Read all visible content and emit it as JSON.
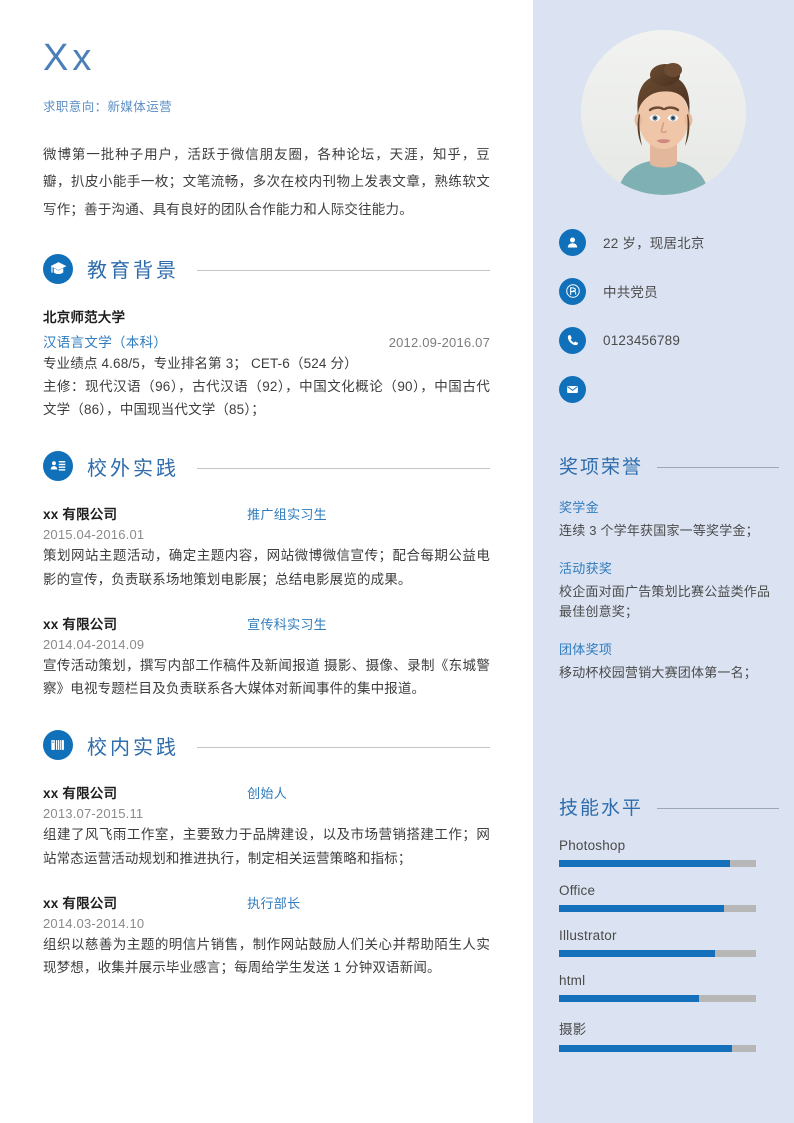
{
  "profile": {
    "name": "Xx",
    "objective": "求职意向：新媒体运营",
    "summary": "微博第一批种子用户，活跃于微信朋友圈，各种论坛，天涯，知乎，豆瓣，扒皮小能手一枚；文笔流畅，多次在校内刊物上发表文章，熟练软文写作；善于沟通、具有良好的团队合作能力和人际交往能力。"
  },
  "contact": {
    "items": [
      {
        "icon": "person-icon",
        "text": "22 岁，现居北京"
      },
      {
        "icon": "party-emblem-icon",
        "text": "中共党员"
      },
      {
        "icon": "phone-icon",
        "text": "0123456789"
      },
      {
        "icon": "mail-icon",
        "text": ""
      }
    ]
  },
  "education": {
    "title": "教育背景",
    "icon": "graduation-cap-icon",
    "school": "北京师范大学",
    "major": "汉语言文学（本科）",
    "daterange": "2012.09-2016.07",
    "details": [
      "专业绩点 4.68/5，专业排名第 3； CET-6（524 分）",
      "主修：现代汉语（96），古代汉语（92），中国文化概论（90），中国古代文学（86），中国现当代文学（85）；"
    ]
  },
  "off_campus": {
    "title": "校外实践",
    "icon": "id-card-icon",
    "entries": [
      {
        "org": "xx 有限公司",
        "role": "推广组实习生",
        "period": "2015.04-2016.01",
        "desc": "策划网站主题活动，确定主题内容，网站微博微信宣传；配合每期公益电影的宣传，负责联系场地策划电影展；总结电影展览的成果。"
      },
      {
        "org": "xx 有限公司",
        "role": "宣传科实习生",
        "period": "2014.04-2014.09",
        "desc": "宣传活动策划，撰写内部工作稿件及新闻报道 摄影、摄像、录制《东城警察》电视专题栏目及负责联系各大媒体对新闻事件的集中报道。"
      }
    ]
  },
  "on_campus": {
    "title": "校内实践",
    "icon": "campus-building-icon",
    "entries": [
      {
        "org": "xx 有限公司",
        "role": "创始人",
        "period": "2013.07-2015.11",
        "desc": "组建了风飞雨工作室，主要致力于品牌建设，以及市场营销搭建工作；网站常态运营活动规划和推进执行，制定相关运营策略和指标；"
      },
      {
        "org": "xx 有限公司",
        "role": "执行部长",
        "period": "2014.03-2014.10",
        "desc": "组织以慈善为主题的明信片销售，制作网站鼓励人们关心并帮助陌生人实现梦想，收集并展示毕业感言；每周给学生发送 1 分钟双语新闻。"
      }
    ]
  },
  "awards": {
    "title": "奖项荣誉",
    "items": [
      {
        "label": "奖学金",
        "desc": "连续 3 个学年获国家一等奖学金；"
      },
      {
        "label": "活动获奖",
        "desc": "校企面对面广告策划比赛公益类作品最佳创意奖；"
      },
      {
        "label": "团体奖项",
        "desc": "移动杯校园营销大赛团体第一名；"
      }
    ]
  },
  "skills": {
    "title": "技能水平",
    "items": [
      {
        "name": "Photoshop",
        "percent": 87
      },
      {
        "name": "Office",
        "percent": 84
      },
      {
        "name": "Illustrator",
        "percent": 79
      },
      {
        "name": "html",
        "percent": 71
      },
      {
        "name": "摄影",
        "percent": 88
      }
    ]
  },
  "colors": {
    "accent": "#1170ba",
    "heading": "#2f6cab",
    "sidebar_bg": "#dbe3f2",
    "bar_fill": "#1470bb",
    "bar_track": "#b7b7b7"
  }
}
